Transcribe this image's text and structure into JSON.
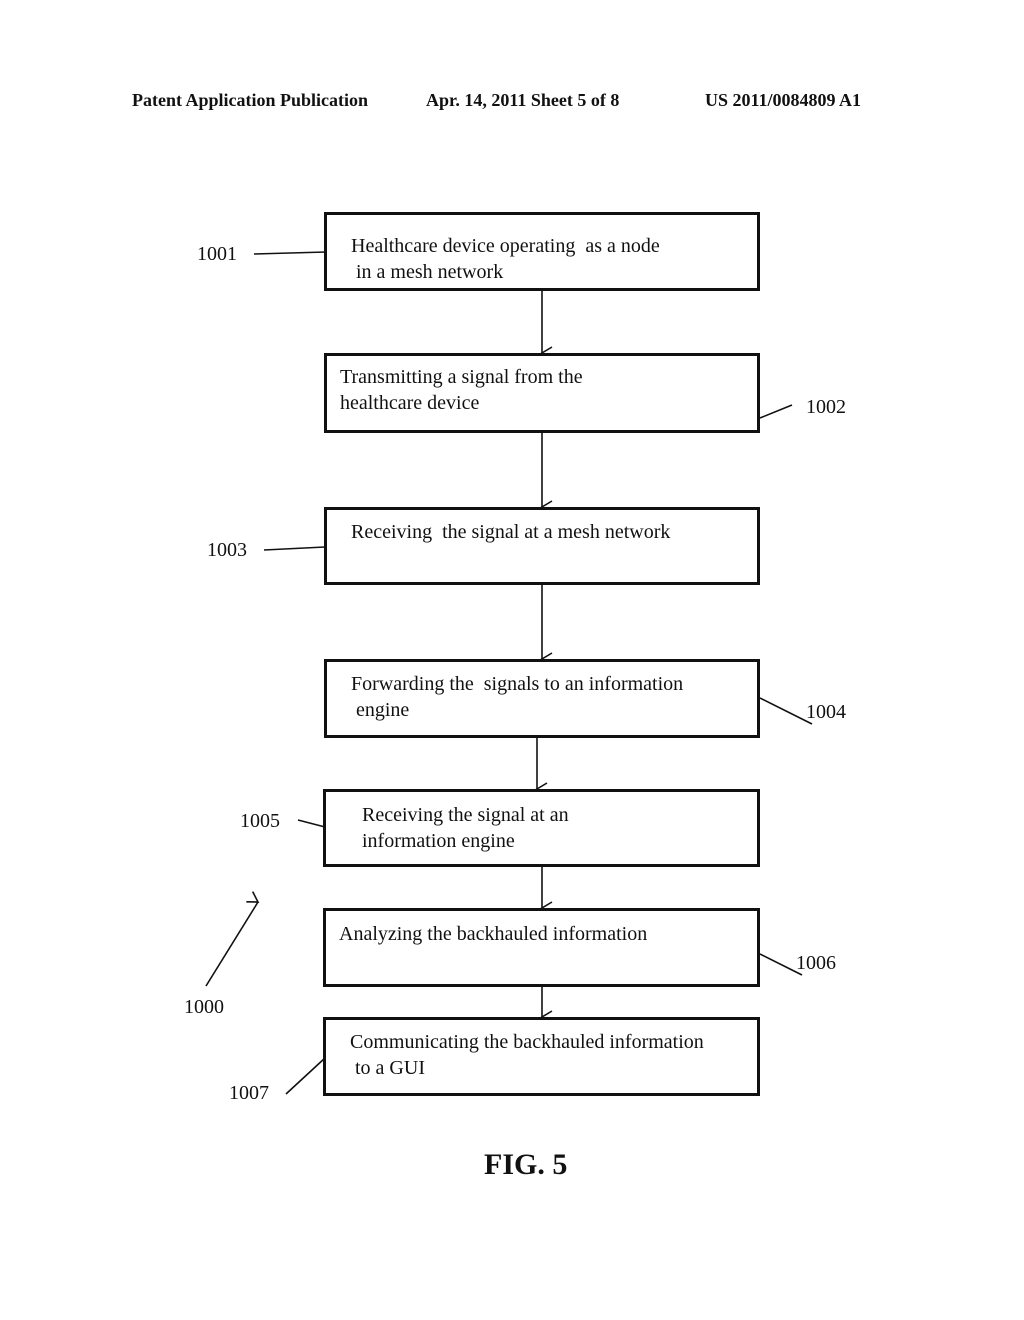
{
  "header": {
    "left": "Patent Application Publication",
    "center": "Apr. 14, 2011  Sheet 5 of 8",
    "right": "US 2011/0084809 A1"
  },
  "steps": [
    {
      "ref": "1001",
      "line1": "Healthcare device operating  as a node",
      "line2": " in a mesh network"
    },
    {
      "ref": "1002",
      "line1": "Transmitting a signal from the",
      "line2": "healthcare device"
    },
    {
      "ref": "1003",
      "line1": "Receiving  the signal at a mesh network",
      "line2": ""
    },
    {
      "ref": "1004",
      "line1": "Forwarding the  signals to an information",
      "line2": " engine"
    },
    {
      "ref": "1005",
      "line1": "Receiving the signal at an",
      "line2": "information engine"
    },
    {
      "ref": "1006",
      "line1": "Analyzing the backhauled information",
      "line2": ""
    },
    {
      "ref": "1007",
      "line1": "Communicating the backhauled information",
      "line2": " to a GUI"
    }
  ],
  "flow_ref": "1000",
  "figure_label": "FIG. 5"
}
